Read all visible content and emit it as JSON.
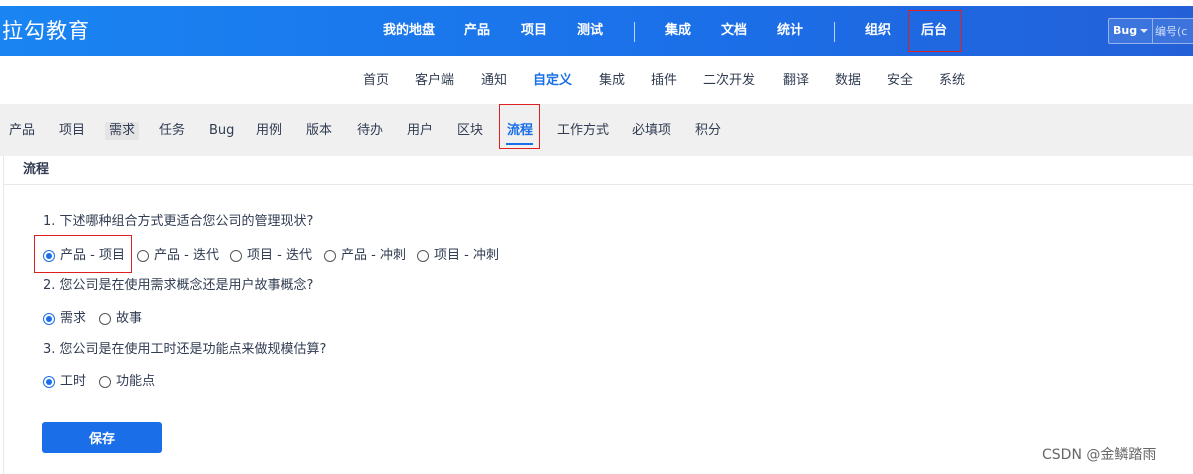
{
  "brand": "拉勾教育",
  "main_nav": [
    "我的地盘",
    "产品",
    "项目",
    "测试",
    "集成",
    "文档",
    "统计",
    "组织",
    "后台"
  ],
  "search": {
    "type": "Bug",
    "placeholder": "编号(c"
  },
  "sub_nav": [
    "首页",
    "客户端",
    "通知",
    "自定义",
    "集成",
    "插件",
    "二次开发",
    "翻译",
    "数据",
    "安全",
    "系统"
  ],
  "tabs": [
    "产品",
    "项目",
    "需求",
    "任务",
    "Bug",
    "用例",
    "版本",
    "待办",
    "用户",
    "区块",
    "流程",
    "工作方式",
    "必填项",
    "积分"
  ],
  "panel": {
    "title": "流程",
    "q1": "1. 下述哪种组合方式更适合您公司的管理现状?",
    "q1_options": [
      "产品 - 项目",
      "产品 - 迭代",
      "项目 - 迭代",
      "产品 - 冲刺",
      "项目 - 冲刺"
    ],
    "q1_selected": "产品 - 项目",
    "q2": "2. 您公司是在使用需求概念还是用户故事概念?",
    "q2_options": [
      "需求",
      "故事"
    ],
    "q2_selected": "需求",
    "q3": "3. 您公司是在使用工时还是功能点来做规模估算?",
    "q3_options": [
      "工时",
      "功能点"
    ],
    "q3_selected": "工时",
    "save": "保存"
  },
  "watermark": "CSDN @金鳞踏雨",
  "colors": {
    "accent": "#1a6fe8",
    "highlight_box": "#e02020",
    "topbar_start": "#1a84f2",
    "topbar_end": "#2360d8"
  }
}
